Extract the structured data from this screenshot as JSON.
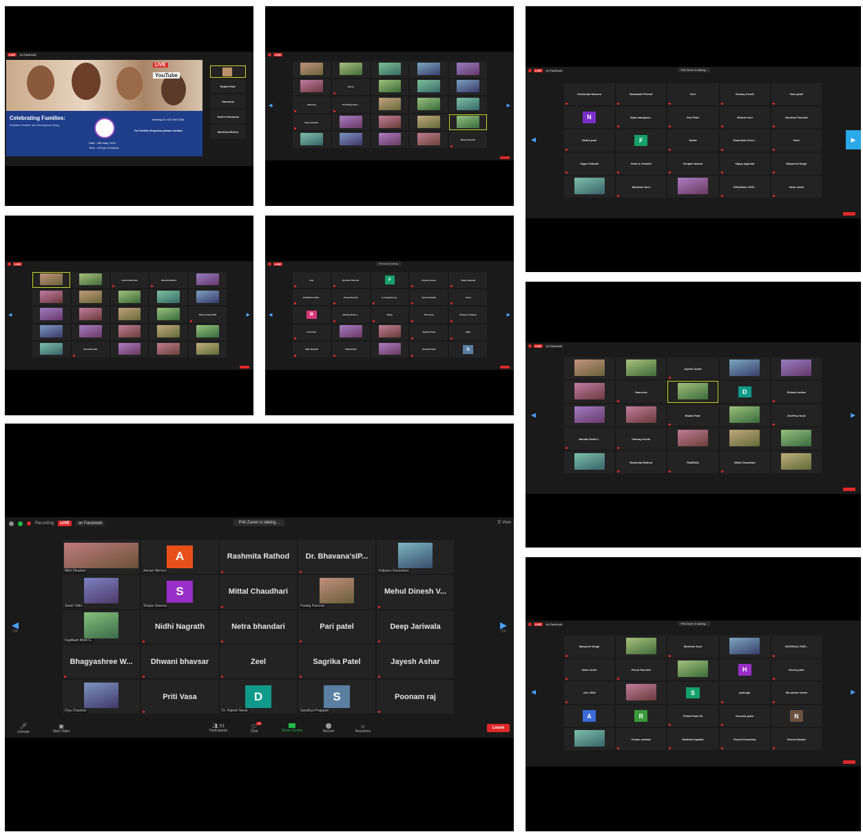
{
  "main": {
    "recording_label": "Recording",
    "live_label": "LIVE",
    "facebook_label": "on Facebook",
    "talking": "Priti Zaveri is talking...",
    "view_label": "View",
    "page_left": "2/4",
    "page_right": "2/4",
    "tiles": [
      {
        "kind": "video",
        "caption": "Mitul Dhadani"
      },
      {
        "kind": "avatar",
        "letter": "A",
        "color": "#e8501a",
        "caption": "Aanam Memon"
      },
      {
        "kind": "name",
        "name": "Rashmita Rathod"
      },
      {
        "kind": "name",
        "name": "Dr. Bhavana'sIP..."
      },
      {
        "kind": "video",
        "caption": "Kalpana Srivastava"
      },
      {
        "kind": "video",
        "caption": "Samit Vidhi"
      },
      {
        "kind": "avatar",
        "letter": "S",
        "color": "#9a2ec8",
        "caption": "Shayla Sharma"
      },
      {
        "kind": "name",
        "name": "Mittal Chaudhari"
      },
      {
        "kind": "video",
        "caption": "Pankaj Panchal"
      },
      {
        "kind": "name",
        "name": "Mehul Dinesh V..."
      },
      {
        "kind": "video",
        "caption": "Kapilkant Modi G..."
      },
      {
        "kind": "name",
        "name": "Nidhi Nagrath"
      },
      {
        "kind": "name",
        "name": "Netra bhandari"
      },
      {
        "kind": "name",
        "name": "Pari patel"
      },
      {
        "kind": "name",
        "name": "Deep Jariwala"
      },
      {
        "kind": "name",
        "name": "Bhagyashree W..."
      },
      {
        "kind": "name",
        "name": "Dhwani bhavsar"
      },
      {
        "kind": "name",
        "name": "Zeel"
      },
      {
        "kind": "name",
        "name": "Sagrika Patel"
      },
      {
        "kind": "name",
        "name": "Jayesh Ashar"
      },
      {
        "kind": "video",
        "caption": "Diya Chauhan"
      },
      {
        "kind": "name",
        "name": "Priti Vasa"
      },
      {
        "kind": "avatar",
        "letter": "D",
        "color": "#0f9a8a",
        "caption": "Dr. Rajesh Naval"
      },
      {
        "kind": "avatar",
        "letter": "S",
        "color": "#5a7fa0",
        "caption": "Sandhya Prajapati"
      },
      {
        "kind": "name",
        "name": "Poonam raj"
      }
    ],
    "toolbar": {
      "unmute": "Unmute",
      "start_video": "Start Video",
      "participants": "Participants",
      "participants_count": "91",
      "chat": "Chat",
      "chat_badge": "14",
      "share": "Share Screen",
      "record": "Record",
      "reactions": "Reactions",
      "leave": "Leave"
    }
  },
  "slide": {
    "live": "LIVE",
    "youtube": "YouTube",
    "headline": "Celebrating Families:",
    "subhead": "Families Creative and Resurgence living",
    "meeting": "Meeting ID: 637 839 3336",
    "contact": "For Further Enquiries please contact",
    "date": "Date : 15th May, 2021",
    "time": "Time : 4:00 pm Onwards",
    "side_names": [
      "Bhakti Patel",
      "Sameena",
      "Yashvi Hindocha",
      "Manisha Mishra"
    ]
  },
  "p2": {
    "names": [
      "Dhruti",
      "Sameena",
      "Prof.Pinky Kam...",
      "Deep Jariwala",
      "Minal Chauhan"
    ]
  },
  "p3": {
    "talking": "Priti Zaveri is talking...",
    "names": [
      "Kashmala Sharma",
      "Saraswati Parmar",
      "Zeel",
      "Vismay trivedi",
      "Yash patel",
      "Dipal mahiyava...",
      "Zeel Patel",
      "Vibhuti mori",
      "Harshini Panchal",
      "Shallu paul",
      "Sarita",
      "Dhanishta Gosv...",
      "Tanvi",
      "Yogen Solanki",
      "Hetal m Solanki",
      "Krupali vasava",
      "Vijaya Agarwal",
      "Manpreet Singh",
      "Mohnish Soni",
      "KHUSHALI PAR...",
      "Neha Joshi"
    ],
    "letters": [
      "N",
      "F"
    ]
  },
  "p4": {
    "names": [
      "Yashvi Hindocha",
      "Manisha Mishra",
      "Bhavin Patel 5600",
      "Rashmita Bali"
    ]
  },
  "p5": {
    "talking": "Priti Zaveri is talking...",
    "names": [
      "Zeel",
      "Harshini Panchal",
      "Krupali vasava",
      "Vijaya Agarwal",
      "KHUSHALI PAR...",
      "Purva Panchal",
      "dr niranjana go...",
      "Samrin Shaikh",
      "Sonal",
      "Jalmika Rohit t...",
      "Rinku",
      "Priti Vasa",
      "Vishwas Chhabra",
      "Isha Patel",
      "Sagrika Patel",
      "Nijal",
      "Nidhi Nagrath",
      "Pinkal Patel",
      "Kaushik Patel"
    ],
    "letters": [
      "F",
      "B",
      "S"
    ]
  },
  "p6": {
    "names": [
      "Jayesh Ashar",
      "Sameena",
      "Shivani suthar",
      "Bhakti Patel",
      "OnePlus Nord",
      "Jalmika Rohit t...",
      "Vismay trivedi",
      "Rashmita Rathod",
      "RAMSHA",
      "Mittal Chaudhari"
    ],
    "letters": [
      "D"
    ]
  },
  "p7": {
    "talking": "Priti Zaveri is talking...",
    "names": [
      "Manpreet Singh",
      "Mohnish Soni",
      "KHUSHALI PAR...",
      "Neha Joshi",
      "Purva Panchal",
      "Heena patel",
      "vivo 1935",
      "padmaja",
      "58-suhani shekh",
      "Pinkal Patel 93",
      "Kaushik patel",
      "Foram undhad",
      "Radhika Kapatel",
      "Khushi Khandhar",
      "Dinesh Maniar"
    ],
    "letters": [
      "H",
      "S",
      "A",
      "R",
      "N"
    ]
  },
  "colors": {
    "accent_blue": "#4aa3ff",
    "live_red": "#e02828",
    "speaker_outline": "#c8dc28",
    "share_green": "#22b84a"
  }
}
